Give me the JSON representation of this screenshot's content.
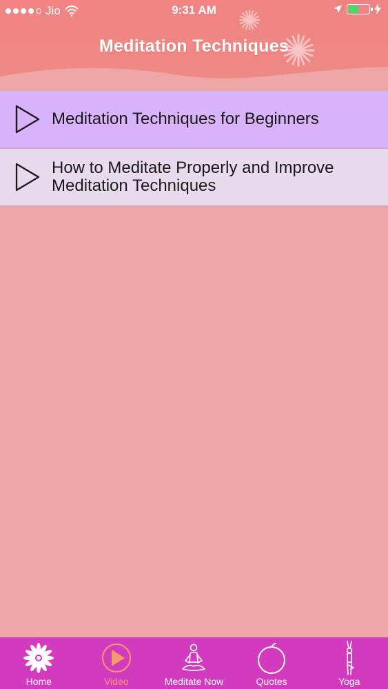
{
  "status_bar": {
    "carrier": "Jio",
    "time": "9:31 AM"
  },
  "header": {
    "title": "Meditation Techniques"
  },
  "videos": [
    {
      "title": "Meditation Techniques for Beginners"
    },
    {
      "title": "How to Meditate Properly and Improve Meditation Techniques"
    }
  ],
  "tabbar": {
    "active": "Video",
    "tabs": [
      {
        "label": "Home",
        "icon": "flower-icon"
      },
      {
        "label": "Video",
        "icon": "play-circle-icon"
      },
      {
        "label": "Meditate Now",
        "icon": "meditating-person-icon"
      },
      {
        "label": "Quotes",
        "icon": "apple-icon"
      },
      {
        "label": "Yoga",
        "icon": "yoga-pose-icon"
      }
    ]
  },
  "colors": {
    "header": "#f08382",
    "background": "#eea6a6",
    "row_first": "#d8b2fa",
    "row_second": "#e8dbed",
    "tabbar": "#d33bbe",
    "active_tab": "#f49a6c"
  }
}
